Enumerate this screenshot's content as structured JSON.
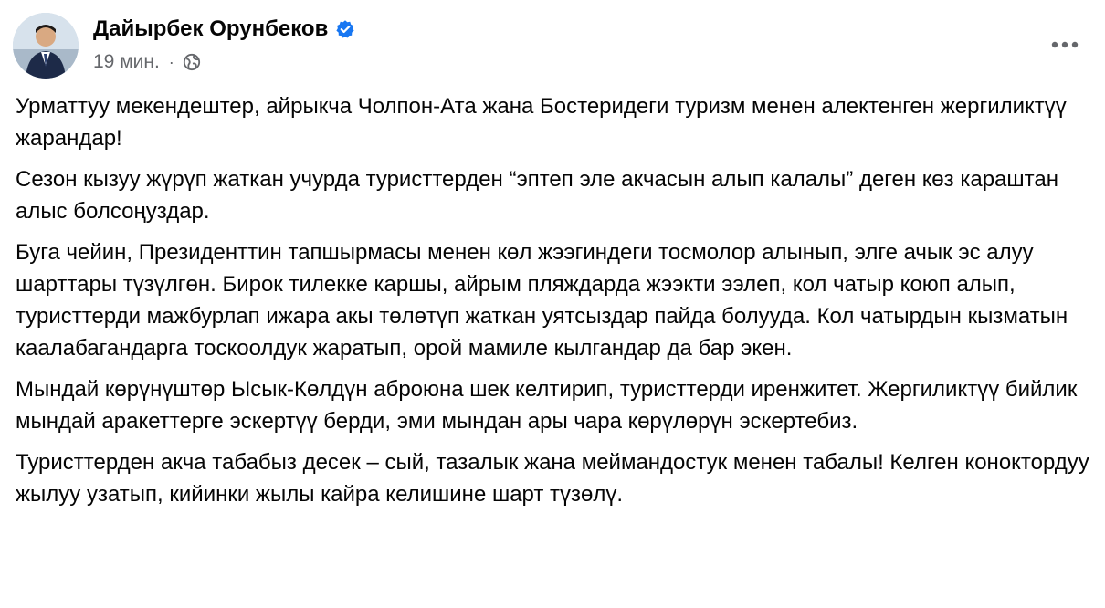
{
  "post": {
    "author": "Дайырбек Орунбеков",
    "verified_icon": "verified-badge-icon",
    "timestamp": "19 мин.",
    "separator": "·",
    "privacy_icon": "globe-icon",
    "more_icon": "more-options-icon",
    "colors": {
      "text": "#050505",
      "secondary": "#65676b",
      "verified": "#1877f2"
    },
    "paragraphs": [
      "Урматтуу мекендештер, айрыкча Чолпон-Ата жана Бостеридеги туризм менен алектенген жергиликтүү жарандар!",
      "Сезон кызуу жүрүп жаткан учурда туристтерден “эптеп эле акчасын алып калалы” деген көз караштан алыс болсоңуздар.",
      "Буга чейин, Президенттин тапшырмасы менен көл жээгиндеги тосмолор алынып, элге ачык эс алуу шарттары түзүлгөн. Бирок тилекке каршы, айрым пляждарда жээкти ээлеп, кол чатыр коюп алып, туристтерди мажбурлап ижара акы төлөтүп жаткан уятсыздар пайда болууда. Кол чатырдын кызматын каалабагандарга тоскоолдук жаратып, орой мамиле кылгандар да бар экен.",
      "Мындай көрүнүштөр Ысык-Көлдүн аброюна шек келтирип, туристтерди иренжитет. Жергиликтүү бийлик мындай аракеттерге эскертүү берди, эми мындан ары чара көрүлөрүн эскертебиз.",
      "Туристтерден акча табабыз десек – сый, тазалык жана меймандостук менен табалы! Келген коноктордуу жылуу узатып, кийинки жылы кайра келишине шарт түзөлү."
    ]
  }
}
